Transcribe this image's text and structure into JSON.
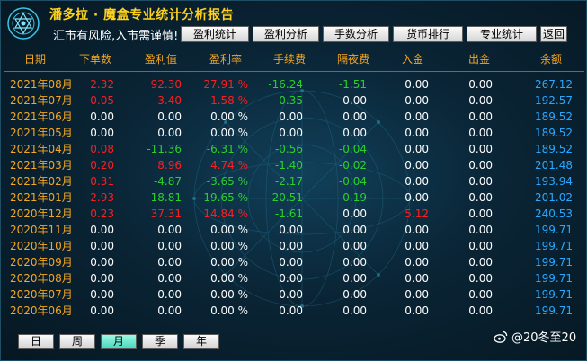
{
  "header": {
    "title": "潘多拉 · 魔盒专业统计分析报告",
    "warning": "汇市有风险,入市需谨慎!",
    "tabs": [
      "盈利统计",
      "盈利分析",
      "手数分析",
      "货币排行",
      "专业统计",
      "返回"
    ]
  },
  "table": {
    "columns": [
      "日期",
      "下单数",
      "盈利值",
      "盈利率",
      "手续费",
      "隔夜费",
      "入金",
      "出金",
      "余额"
    ],
    "rows": [
      [
        "2021年08月",
        "2.32",
        "92.30",
        "27.91 %",
        "-16.24",
        "-1.51",
        "0.00",
        "0.00",
        "267.12"
      ],
      [
        "2021年07月",
        "0.05",
        "3.40",
        "1.58 %",
        "-0.35",
        "0.00",
        "0.00",
        "0.00",
        "192.57"
      ],
      [
        "2021年06月",
        "0.00",
        "0.00",
        "0.00 %",
        "0.00",
        "0.00",
        "0.00",
        "0.00",
        "189.52"
      ],
      [
        "2021年05月",
        "0.00",
        "0.00",
        "0.00 %",
        "0.00",
        "0.00",
        "0.00",
        "0.00",
        "189.52"
      ],
      [
        "2021年04月",
        "0.08",
        "-11.36",
        "-6.31 %",
        "-0.56",
        "-0.04",
        "0.00",
        "0.00",
        "189.52"
      ],
      [
        "2021年03月",
        "0.20",
        "8.96",
        "4.74 %",
        "-1.40",
        "-0.02",
        "0.00",
        "0.00",
        "201.48"
      ],
      [
        "2021年02月",
        "0.31",
        "-4.87",
        "-3.65 %",
        "-2.17",
        "-0.04",
        "0.00",
        "0.00",
        "193.94"
      ],
      [
        "2021年01月",
        "2.93",
        "-18.81",
        "-19.65 %",
        "-20.51",
        "-0.19",
        "0.00",
        "0.00",
        "201.02"
      ],
      [
        "2020年12月",
        "0.23",
        "37.31",
        "14.84 %",
        "-1.61",
        "0.00",
        "5.12",
        "0.00",
        "240.53"
      ],
      [
        "2020年11月",
        "0.00",
        "0.00",
        "0.00 %",
        "0.00",
        "0.00",
        "0.00",
        "0.00",
        "199.71"
      ],
      [
        "2020年10月",
        "0.00",
        "0.00",
        "0.00 %",
        "0.00",
        "0.00",
        "0.00",
        "0.00",
        "199.71"
      ],
      [
        "2020年09月",
        "0.00",
        "0.00",
        "0.00 %",
        "0.00",
        "0.00",
        "0.00",
        "0.00",
        "199.71"
      ],
      [
        "2020年08月",
        "0.00",
        "0.00",
        "0.00 %",
        "0.00",
        "0.00",
        "0.00",
        "0.00",
        "199.71"
      ],
      [
        "2020年07月",
        "0.00",
        "0.00",
        "0.00 %",
        "0.00",
        "0.00",
        "0.00",
        "0.00",
        "199.71"
      ],
      [
        "2020年06月",
        "0.00",
        "0.00",
        "0.00 %",
        "0.00",
        "0.00",
        "0.00",
        "0.00",
        "199.71"
      ]
    ]
  },
  "periods": {
    "items": [
      "日",
      "周",
      "月",
      "季",
      "年"
    ],
    "active": "月"
  },
  "watermark": {
    "text": "@20冬至20",
    "icon": "weibo-icon"
  },
  "colors": {
    "positive": "#ff1e1e",
    "negative": "#2bd12b",
    "neutral": "#ffffff",
    "header_gold": "#f5a623",
    "balance": "#29a8ff",
    "title": "#ffd21c",
    "active_period": "#45d7bd"
  }
}
